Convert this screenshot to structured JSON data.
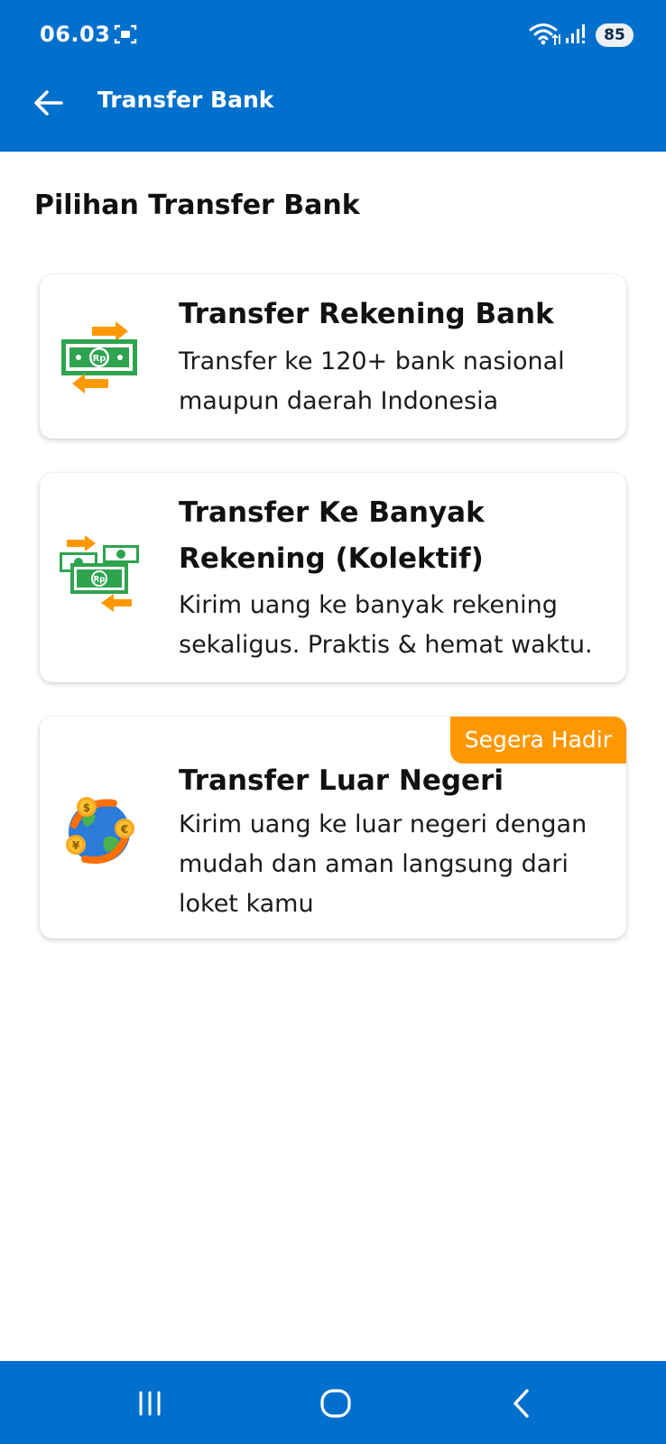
{
  "status_bar": {
    "time": "06.03",
    "battery": "85",
    "icons": [
      "screenshot-icon",
      "wifi-icon",
      "signal-icon"
    ]
  },
  "app_bar": {
    "title": "Transfer Bank",
    "back_icon": "arrow-left-icon"
  },
  "section_title": "Pilihan Transfer Bank",
  "options": [
    {
      "title": "Transfer Rekening Bank",
      "description": "Transfer ke 120+ bank nasional maupun daerah Indonesia",
      "icon": "money-transfer-icon"
    },
    {
      "title": "Transfer Ke Banyak Rekening (Kolektif)",
      "description": "Kirim uang ke banyak rekening sekaligus. Praktis & hemat waktu.",
      "icon": "bulk-transfer-icon"
    },
    {
      "title": "Transfer Luar Negeri",
      "description": "Kirim uang ke luar negeri dengan mudah dan aman langsung dari loket kamu",
      "icon": "global-currency-icon",
      "badge": "Segera Hadir"
    }
  ],
  "nav_bar": {
    "buttons": [
      "recent-apps-icon",
      "home-icon",
      "back-icon"
    ]
  },
  "colors": {
    "primary": "#0070CC",
    "accent": "#FF9800",
    "money_green": "#2EA44F"
  }
}
